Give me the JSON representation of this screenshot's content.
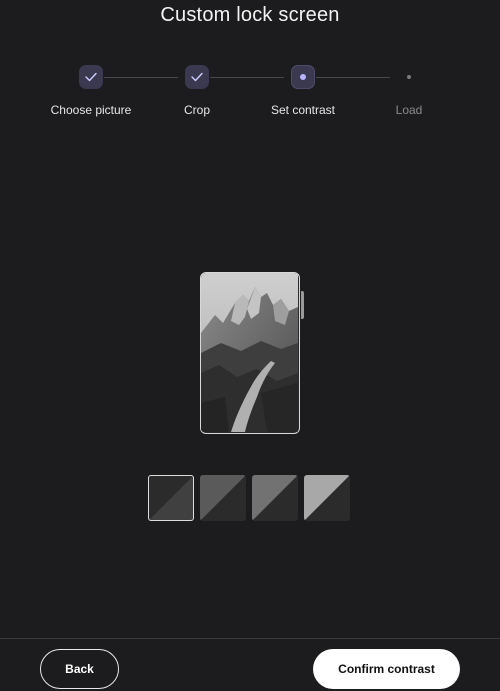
{
  "title": "Custom lock screen",
  "stepper": {
    "steps": [
      {
        "label": "Choose picture",
        "status": "complete",
        "icon": "check-icon"
      },
      {
        "label": "Crop",
        "status": "complete",
        "icon": "check-icon"
      },
      {
        "label": "Set contrast",
        "status": "current",
        "icon": "dot-icon"
      },
      {
        "label": "Load",
        "status": "pending",
        "icon": "dot-icon"
      }
    ]
  },
  "preview": {
    "image": "mountain-landscape-grayscale"
  },
  "contrast_options": [
    {
      "selected": true,
      "colors": [
        "#2b2b2b",
        "#404040"
      ]
    },
    {
      "selected": false,
      "colors": [
        "#2b2b2b",
        "#5a5a5a"
      ]
    },
    {
      "selected": false,
      "colors": [
        "#2b2b2b",
        "#727272"
      ]
    },
    {
      "selected": false,
      "colors": [
        "#2b2b2b",
        "#a8a8a8"
      ]
    }
  ],
  "footer": {
    "back_label": "Back",
    "confirm_label": "Confirm contrast"
  },
  "colors": {
    "background": "#1c1c1e",
    "step_complete": "#3a3950",
    "step_current_dot": "#b8b4ff",
    "primary_button": "#ffffff"
  }
}
